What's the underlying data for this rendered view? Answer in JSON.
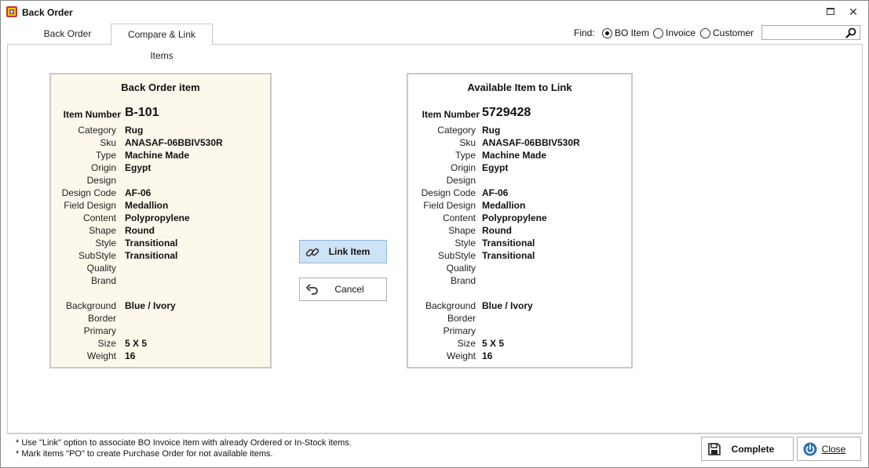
{
  "window": {
    "title": "Back Order"
  },
  "tabs": [
    {
      "label": "Back Order",
      "active": false
    },
    {
      "label": "Compare & Link Items",
      "active": true
    }
  ],
  "find": {
    "label": "Find:",
    "options": [
      {
        "label": "BO Item",
        "checked": true
      },
      {
        "label": "Invoice",
        "checked": false
      },
      {
        "label": "Customer",
        "checked": false
      }
    ],
    "search_value": ""
  },
  "back_order_panel": {
    "title": "Back Order item",
    "item_number_label": "Item Number",
    "item_number": "B-101",
    "fields": [
      {
        "label": "Category",
        "value": "Rug"
      },
      {
        "label": "Sku",
        "value": "ANASAF-06BBIV530R"
      },
      {
        "label": "Type",
        "value": "Machine Made"
      },
      {
        "label": "Origin",
        "value": "Egypt"
      },
      {
        "label": "Design",
        "value": ""
      },
      {
        "label": "Design Code",
        "value": "AF-06"
      },
      {
        "label": "Field Design",
        "value": "Medallion"
      },
      {
        "label": "Content",
        "value": "Polypropylene"
      },
      {
        "label": "Shape",
        "value": "Round"
      },
      {
        "label": "Style",
        "value": "Transitional"
      },
      {
        "label": "SubStyle",
        "value": "Transitional"
      },
      {
        "label": "Quality",
        "value": ""
      },
      {
        "label": "Brand",
        "value": ""
      },
      {
        "label": "",
        "value": ""
      },
      {
        "label": "Background",
        "value": "Blue / Ivory"
      },
      {
        "label": "Border",
        "value": ""
      },
      {
        "label": "Primary",
        "value": ""
      },
      {
        "label": "Size",
        "value": "5 X 5"
      },
      {
        "label": "Weight",
        "value": "16"
      }
    ]
  },
  "available_panel": {
    "title": "Available Item to Link",
    "item_number_label": "Item Number",
    "item_number": "5729428",
    "fields": [
      {
        "label": "Category",
        "value": "Rug"
      },
      {
        "label": "Sku",
        "value": "ANASAF-06BBIV530R"
      },
      {
        "label": "Type",
        "value": "Machine Made"
      },
      {
        "label": "Origin",
        "value": "Egypt"
      },
      {
        "label": "Design",
        "value": ""
      },
      {
        "label": "Design Code",
        "value": "AF-06"
      },
      {
        "label": "Field Design",
        "value": "Medallion"
      },
      {
        "label": "Content",
        "value": "Polypropylene"
      },
      {
        "label": "Shape",
        "value": "Round"
      },
      {
        "label": "Style",
        "value": "Transitional"
      },
      {
        "label": "SubStyle",
        "value": "Transitional"
      },
      {
        "label": "Quality",
        "value": ""
      },
      {
        "label": "Brand",
        "value": ""
      },
      {
        "label": "",
        "value": ""
      },
      {
        "label": "Background",
        "value": "Blue / Ivory"
      },
      {
        "label": "Border",
        "value": ""
      },
      {
        "label": "Primary",
        "value": ""
      },
      {
        "label": "Size",
        "value": "5 X 5"
      },
      {
        "label": "Weight",
        "value": "16"
      }
    ]
  },
  "actions": {
    "link_label": "Link Item",
    "cancel_label": "Cancel",
    "complete_label": "Complete",
    "close_label": "Close"
  },
  "notes": [
    "* Use \"Link\" option to associate BO Invoice Item with already Ordered or In-Stock items.",
    "* Mark items \"PO\" to create Purchase Order for not available items."
  ],
  "colors": {
    "left_panel_bg": "#fdf8ec",
    "link_button_bg": "#cfe3f7",
    "accent_blue": "#2a6db5"
  },
  "icons": {
    "app": "rug-app-icon",
    "link": "chain-link-icon",
    "cancel": "undo-arrow-icon",
    "complete": "floppy-disk-icon",
    "close": "power-icon",
    "search": "magnifier-icon"
  }
}
